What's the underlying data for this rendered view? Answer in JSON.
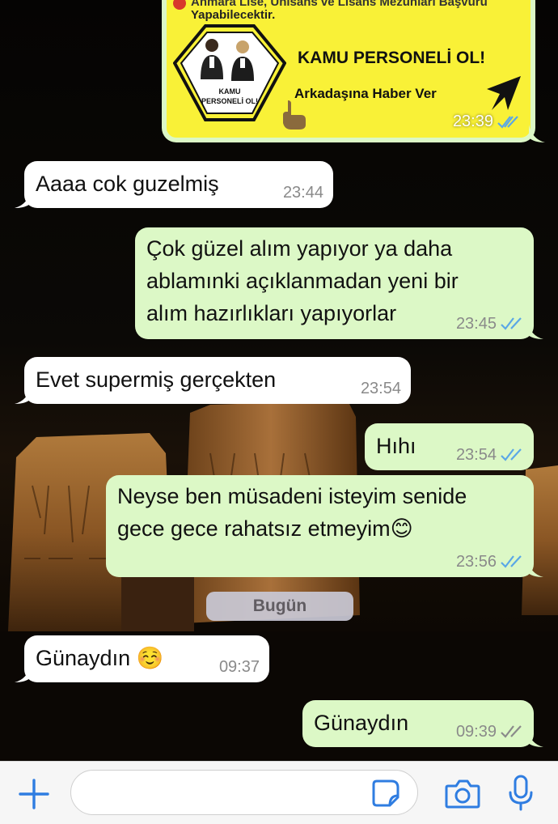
{
  "colors": {
    "incoming_bubble": "#ffffff",
    "outgoing_bubble": "#dcf8c6",
    "read_ticks": "#5aa7e6",
    "delivered_ticks": "#8a8a8a",
    "accent": "#2f7de1"
  },
  "image_message": {
    "line1": "Anmara Lise, Ünisans ve Lisans Mezunları Başvuru",
    "line2": "Yapabilecektir.",
    "badge_text_1": "KAMU",
    "badge_text_2": "PERSONELİ OL!",
    "title": "KAMU PERSONELİ OL!",
    "subtitle": "Arkadaşına Haber Ver",
    "time": "23:39",
    "status": "read"
  },
  "messages": [
    {
      "direction": "in",
      "text": "Aaaa cok guzelmiş",
      "time": "23:44"
    },
    {
      "direction": "out",
      "lines": [
        "Çok güzel alım yapıyor ya daha",
        "ablamınki açıklanmadan yeni bir",
        "alım hazırlıkları yapıyorlar"
      ],
      "time": "23:45",
      "status": "read"
    },
    {
      "direction": "in",
      "text": "Evet supermiş gerçekten",
      "time": "23:54"
    },
    {
      "direction": "out",
      "text": "Hıhı",
      "time": "23:54",
      "status": "read"
    },
    {
      "direction": "out",
      "lines": [
        "Neyse ben müsadeni isteyim senide",
        "gece gece rahatsız etmeyim😊"
      ],
      "time": "23:56",
      "status": "read"
    },
    {
      "direction": "in",
      "text": "Günaydın ☺️",
      "time": "09:37"
    },
    {
      "direction": "out",
      "text": "Günaydın",
      "time": "09:39",
      "status": "delivered"
    }
  ],
  "date_separator": "Bugün",
  "input_bar": {
    "placeholder": "",
    "value": "",
    "icons": [
      "plus-icon",
      "sticker-icon",
      "camera-icon",
      "microphone-icon"
    ]
  }
}
